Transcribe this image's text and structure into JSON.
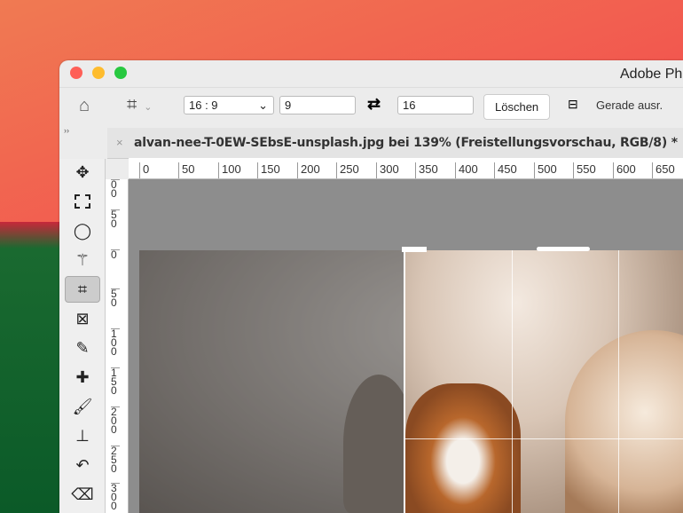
{
  "window": {
    "title": "Adobe Ph"
  },
  "options": {
    "aspect_preset": "16 : 9",
    "width_value": "9",
    "height_value": "16",
    "clear_label": "Löschen",
    "straighten_label": "Gerade ausr."
  },
  "document": {
    "tab_title": "alvan-nee-T-0EW-SEbsE-unsplash.jpg bei 139% (Freistellungsvorschau, RGB/8) *"
  },
  "panel": {
    "collapse": "››"
  },
  "ruler": {
    "h": [
      "0",
      "50",
      "100",
      "150",
      "200",
      "250",
      "300",
      "350",
      "400",
      "450",
      "500",
      "550",
      "600",
      "650"
    ],
    "v": [
      "00",
      "50",
      "0",
      "50",
      "100",
      "150",
      "200",
      "250",
      "300"
    ]
  },
  "tools": [
    "move",
    "marquee",
    "lasso",
    "magic-wand",
    "crop",
    "frame",
    "eyedropper",
    "healing",
    "brush",
    "stamp",
    "history-brush",
    "eraser"
  ]
}
